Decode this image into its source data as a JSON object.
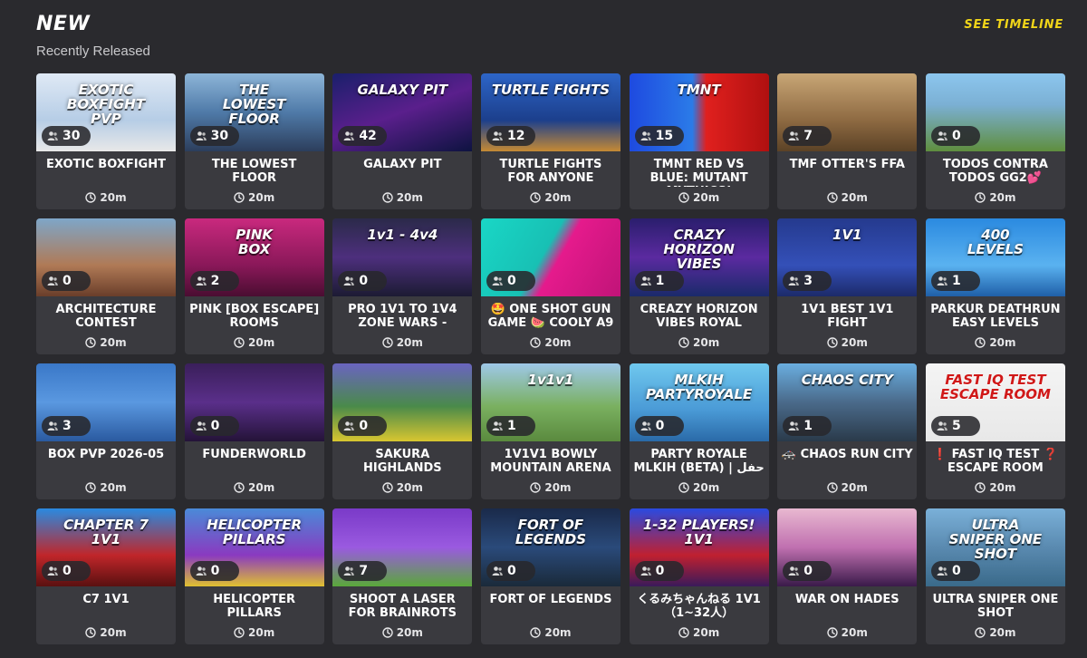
{
  "header": {
    "title": "NEW",
    "subtitle": "Recently Released",
    "timeline_label": "SEE TIMELINE"
  },
  "icons": {
    "players": "person-icon",
    "duration": "clock-icon"
  },
  "colors": {
    "background": "#2a2a2e",
    "card": "#3a3a3f",
    "accent": "#f0d519"
  },
  "cards": [
    {
      "name": "EXOTIC BOXFIGHT",
      "players": "30",
      "duration": "20m",
      "thumb_text": "EXOTIC\nBOXFIGHT\nPVP",
      "bg": "linear-gradient(180deg,#dfe9f5 0%,#b6cde6 60%,#e8e8e8 100%)"
    },
    {
      "name": "THE LOWEST FLOOR",
      "players": "30",
      "duration": "20m",
      "thumb_text": "THE\nLOWEST\nFLOOR",
      "bg": "linear-gradient(180deg,#8db5d8 0%,#4f7aa8 50%,#2c3e5c 100%)"
    },
    {
      "name": "GALAXY PIT",
      "players": "42",
      "duration": "20m",
      "thumb_text": "GALAXY PIT",
      "bg": "linear-gradient(160deg,#1a1f6b 0%,#5a1f8c 50%,#0d1340 100%)"
    },
    {
      "name": "TURTLE FIGHTS FOR ANYONE",
      "players": "12",
      "duration": "20m",
      "thumb_text": "TURTLE FIGHTS",
      "bg": "linear-gradient(180deg,#2d65c7 0%,#1c3f8c 60%,#c58a34 100%)"
    },
    {
      "name": "TMNT RED VS BLUE: MUTANT MYTHICS!",
      "players": "15",
      "duration": "20m",
      "thumb_text": "TMNT",
      "bg": "linear-gradient(90deg,#1e4ae0 0%,#2b7be8 45%,#e0201e 55%,#b01010 100%)"
    },
    {
      "name": "TMF OTTER'S FFA",
      "players": "7",
      "duration": "20m",
      "thumb_text": "",
      "bg": "linear-gradient(180deg,#c8a676 0%,#8e6a42 60%,#5b4226 100%)"
    },
    {
      "name": "TODOS CONTRA TODOS GG2💕",
      "players": "0",
      "duration": "20m",
      "thumb_text": "",
      "bg": "linear-gradient(180deg,#8cc6ee 0%,#7bb0d4 40%,#5f8e3e 100%)"
    },
    {
      "name": "ARCHITECTURE CONTEST",
      "players": "0",
      "duration": "20m",
      "thumb_text": "",
      "bg": "linear-gradient(180deg,#7ea6c8 0%,#b07a56 60%,#6a3e2a 100%)"
    },
    {
      "name": "PINK [BOX ESCAPE] ROOMS",
      "players": "2",
      "duration": "20m",
      "thumb_text": "PINK\nBOX",
      "bg": "linear-gradient(180deg,#c9297e 0%,#8a1859 60%,#4a0d31 100%)"
    },
    {
      "name": "PRO 1V1 TO 1V4 ZONE WARS -",
      "players": "0",
      "duration": "20m",
      "thumb_text": "1v1 - 4v4",
      "bg": "linear-gradient(180deg,#2b2a4a 0%,#4d2f7d 50%,#1c1b33 100%)"
    },
    {
      "name": "🤩 ONE SHOT GUN GAME 🍉 COOLY A9",
      "players": "0",
      "duration": "20m",
      "thumb_text": "",
      "bg": "linear-gradient(120deg,#19d7c6 0%,#18c0b4 45%,#e51a8c 55%,#c01478 100%)"
    },
    {
      "name": "CREAZY HORIZON VIBES ROYAL",
      "players": "1",
      "duration": "20m",
      "thumb_text": "CRAZY\nHORIZON\nVIBES",
      "bg": "linear-gradient(180deg,#2a1e6d 0%,#5b2aa0 50%,#1a2a6a 100%)"
    },
    {
      "name": "1V1 BEST 1V1 FIGHT",
      "players": "3",
      "duration": "20m",
      "thumb_text": "1V1",
      "bg": "linear-gradient(180deg,#253a8e 0%,#3450b8 60%,#1c2a6a 100%)"
    },
    {
      "name": "PARKUR DEATHRUN EASY LEVELS",
      "players": "1",
      "duration": "20m",
      "thumb_text": "400\nLEVELS",
      "bg": "linear-gradient(180deg,#2b8ae0 0%,#5ab2f0 60%,#1f5fa8 100%)"
    },
    {
      "name": "BOX PVP 2026-05",
      "players": "3",
      "duration": "20m",
      "thumb_text": "",
      "bg": "linear-gradient(180deg,#3a78c8 0%,#5a98e0 50%,#2a5aa0 100%)"
    },
    {
      "name": "FUNDERWORLD",
      "players": "0",
      "duration": "20m",
      "thumb_text": "",
      "bg": "linear-gradient(180deg,#3a1f5a 0%,#5a2f8a 50%,#241338 100%)"
    },
    {
      "name": "SAKURA HIGHLANDS",
      "players": "0",
      "duration": "20m",
      "thumb_text": "",
      "bg": "linear-gradient(180deg,#6a64c0 0%,#4a8a4a 55%,#d8c630 100%)"
    },
    {
      "name": "1V1V1 BOWLY MOUNTAIN ARENA",
      "players": "1",
      "duration": "20m",
      "thumb_text": "1v1v1",
      "bg": "linear-gradient(180deg,#9ec8e8 0%,#7ab060 55%,#5a8a3e 100%)"
    },
    {
      "name": "PARTY ROYALE MLKIH (BETA) | حفل",
      "players": "0",
      "duration": "20m",
      "thumb_text": "MLKIH\nPARTYROYALE",
      "bg": "linear-gradient(180deg,#6fc8ee 0%,#4a9ad6 60%,#2a6aa8 100%)"
    },
    {
      "name": "🚓 CHAOS RUN CITY",
      "players": "1",
      "duration": "20m",
      "thumb_text": "CHAOS CITY",
      "bg": "linear-gradient(180deg,#6aaee0 0%,#4a6a8a 50%,#2a3a4a 100%)"
    },
    {
      "name": "❗ FAST IQ TEST ❓ ESCAPE ROOM",
      "players": "5",
      "duration": "20m",
      "thumb_text": "FAST IQ TEST\nESCAPE ROOM",
      "bg": "linear-gradient(180deg,#f4f4f4 0%,#e8e8e8 100%)"
    },
    {
      "name": "C7 1V1",
      "players": "0",
      "duration": "20m",
      "thumb_text": "CHAPTER 7\n1V1",
      "bg": "linear-gradient(180deg,#2a8ae0 0%,#c0262a 60%,#5a1010 100%)"
    },
    {
      "name": "HELICOPTER PILLARS",
      "players": "0",
      "duration": "20m",
      "thumb_text": "HELICOPTER\nPILLARS",
      "bg": "linear-gradient(180deg,#4a8ad8 0%,#8a3ac0 60%,#e0c030 100%)"
    },
    {
      "name": "SHOOT A LASER FOR BRAINROTS",
      "players": "7",
      "duration": "20m",
      "thumb_text": "",
      "bg": "linear-gradient(180deg,#7a3ac8 0%,#9a5ae0 50%,#5aa83a 100%)"
    },
    {
      "name": "FORT OF LEGENDS",
      "players": "0",
      "duration": "20m",
      "thumb_text": "FORT OF\nLEGENDS",
      "bg": "linear-gradient(180deg,#1a2a4a 0%,#2a4a7a 50%,#1a2a3a 100%)"
    },
    {
      "name": "くるみちゃんねる 1V1（1~32人）",
      "players": "0",
      "duration": "20m",
      "thumb_text": "1-32 PLAYERS!\n1V1",
      "bg": "linear-gradient(180deg,#2a4ae0 0%,#c02030 60%,#3a1a5a 100%)"
    },
    {
      "name": "WAR ON HADES",
      "players": "0",
      "duration": "20m",
      "thumb_text": "",
      "bg": "linear-gradient(180deg,#e8b8d0 0%,#c070b0 50%,#3a1a4a 100%)"
    },
    {
      "name": "ULTRA SNIPER ONE SHOT",
      "players": "0",
      "duration": "20m",
      "thumb_text": "ULTRA\nSNIPER ONE SHOT",
      "bg": "linear-gradient(180deg,#7ab0d8 0%,#5a8ab0 50%,#3a6a8a 100%)"
    }
  ]
}
